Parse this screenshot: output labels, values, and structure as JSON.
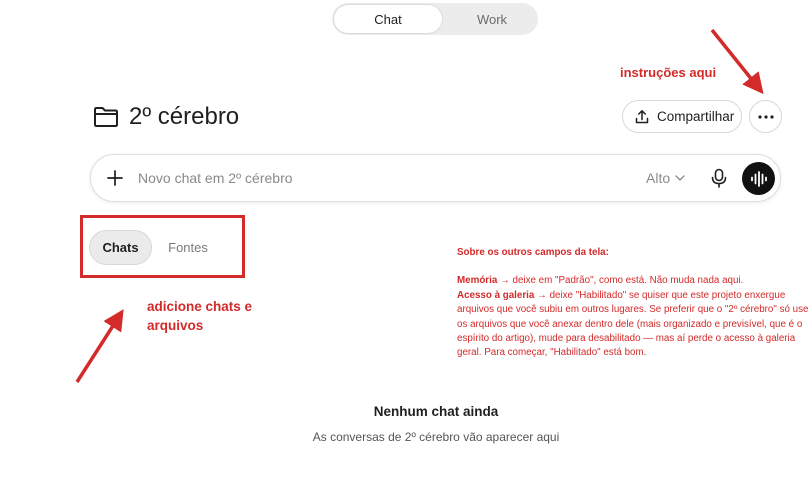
{
  "mode_toggle": {
    "chat_label": "Chat",
    "work_label": "Work",
    "active": "Chat"
  },
  "header": {
    "title": "2º cérebro",
    "share_label": "Compartilhar",
    "icons": {
      "folder": "folder-icon",
      "share": "upload-icon",
      "more": "ellipsis-icon"
    }
  },
  "chat_input": {
    "placeholder": "Novo chat em 2º cérebro",
    "model_label": "Alto",
    "icons": {
      "plus": "plus-icon",
      "model": "chevron-down-icon",
      "mic": "microphone-icon",
      "voice": "voice-waveform-icon"
    }
  },
  "tabs": [
    {
      "label": "Chats",
      "active": true
    },
    {
      "label": "Fontes",
      "active": false
    }
  ],
  "annotations": {
    "instrucoes": "instruções aqui",
    "adicione": "adicione chats e arquivos",
    "notes_heading": "Sobre os outros campos da tela:",
    "memoria_label": "Memória →",
    "memoria_text": " deixe em \"Padrão\", como está. Não muda nada aqui.",
    "galeria_label": "Acesso à galeria →",
    "galeria_text": " deixe \"Habilitado\" se quiser que este projeto enxergue arquivos que você subiu em outros lugares. Se preferir que o \"2º cérebro\" só use os arquivos que você anexar dentro dele (mais organizado e previsível, que é o espírito do artigo), mude para desabilitado — mas aí perde o acesso à galeria geral. Para começar, \"Habilitado\" está bom.",
    "color": "#d32a2a"
  },
  "empty_state": {
    "title": "Nenhum chat ainda",
    "subtitle": "As conversas de 2º cérebro vão aparecer aqui"
  }
}
